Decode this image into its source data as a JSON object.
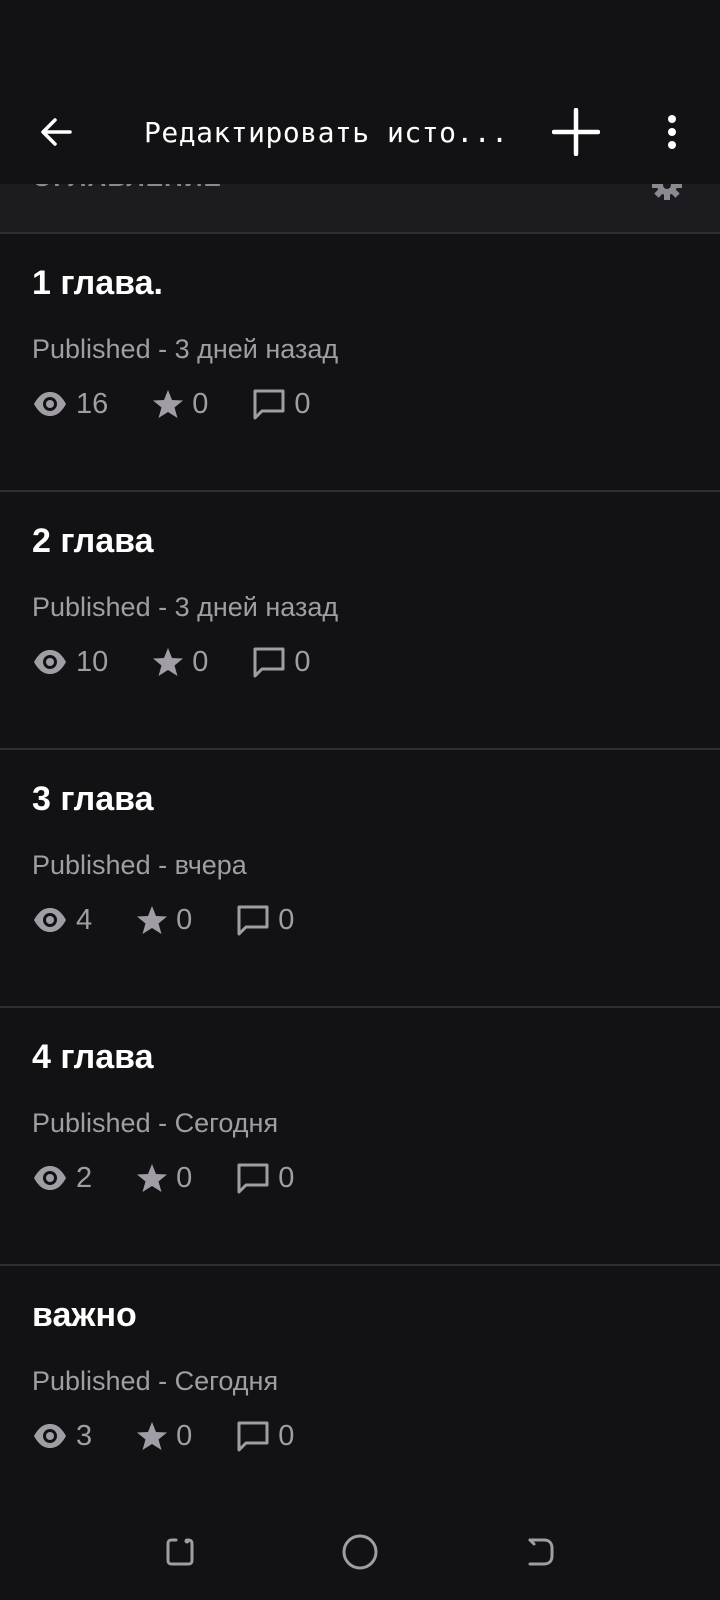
{
  "app_bar": {
    "title": "Редактировать исто..."
  },
  "section": {
    "title": "ОГЛАВЛЕНИЕ"
  },
  "parts": [
    {
      "title": "1 глава.",
      "status": "Published - 3 дней назад",
      "views": "16",
      "votes": "0",
      "comments": "0"
    },
    {
      "title": "2 глава",
      "status": "Published - 3 дней назад",
      "views": "10",
      "votes": "0",
      "comments": "0"
    },
    {
      "title": "3 глава",
      "status": "Published - вчера",
      "views": "4",
      "votes": "0",
      "comments": "0"
    },
    {
      "title": "4 глава",
      "status": "Published - Сегодня",
      "views": "2",
      "votes": "0",
      "comments": "0"
    },
    {
      "title": "важно",
      "status": "Published - Сегодня",
      "views": "3",
      "votes": "0",
      "comments": "0"
    }
  ],
  "icons": {
    "back": "arrow-left-icon",
    "add": "plus-icon",
    "more": "more-vertical-icon",
    "settings": "gear-icon",
    "views": "eye-icon",
    "votes": "star-icon",
    "comments": "comment-icon"
  },
  "colors": {
    "background": "#121114",
    "header_background": "#1c1b1f",
    "secondary_text": "#a09ea4",
    "divider": "#2e2d32"
  }
}
